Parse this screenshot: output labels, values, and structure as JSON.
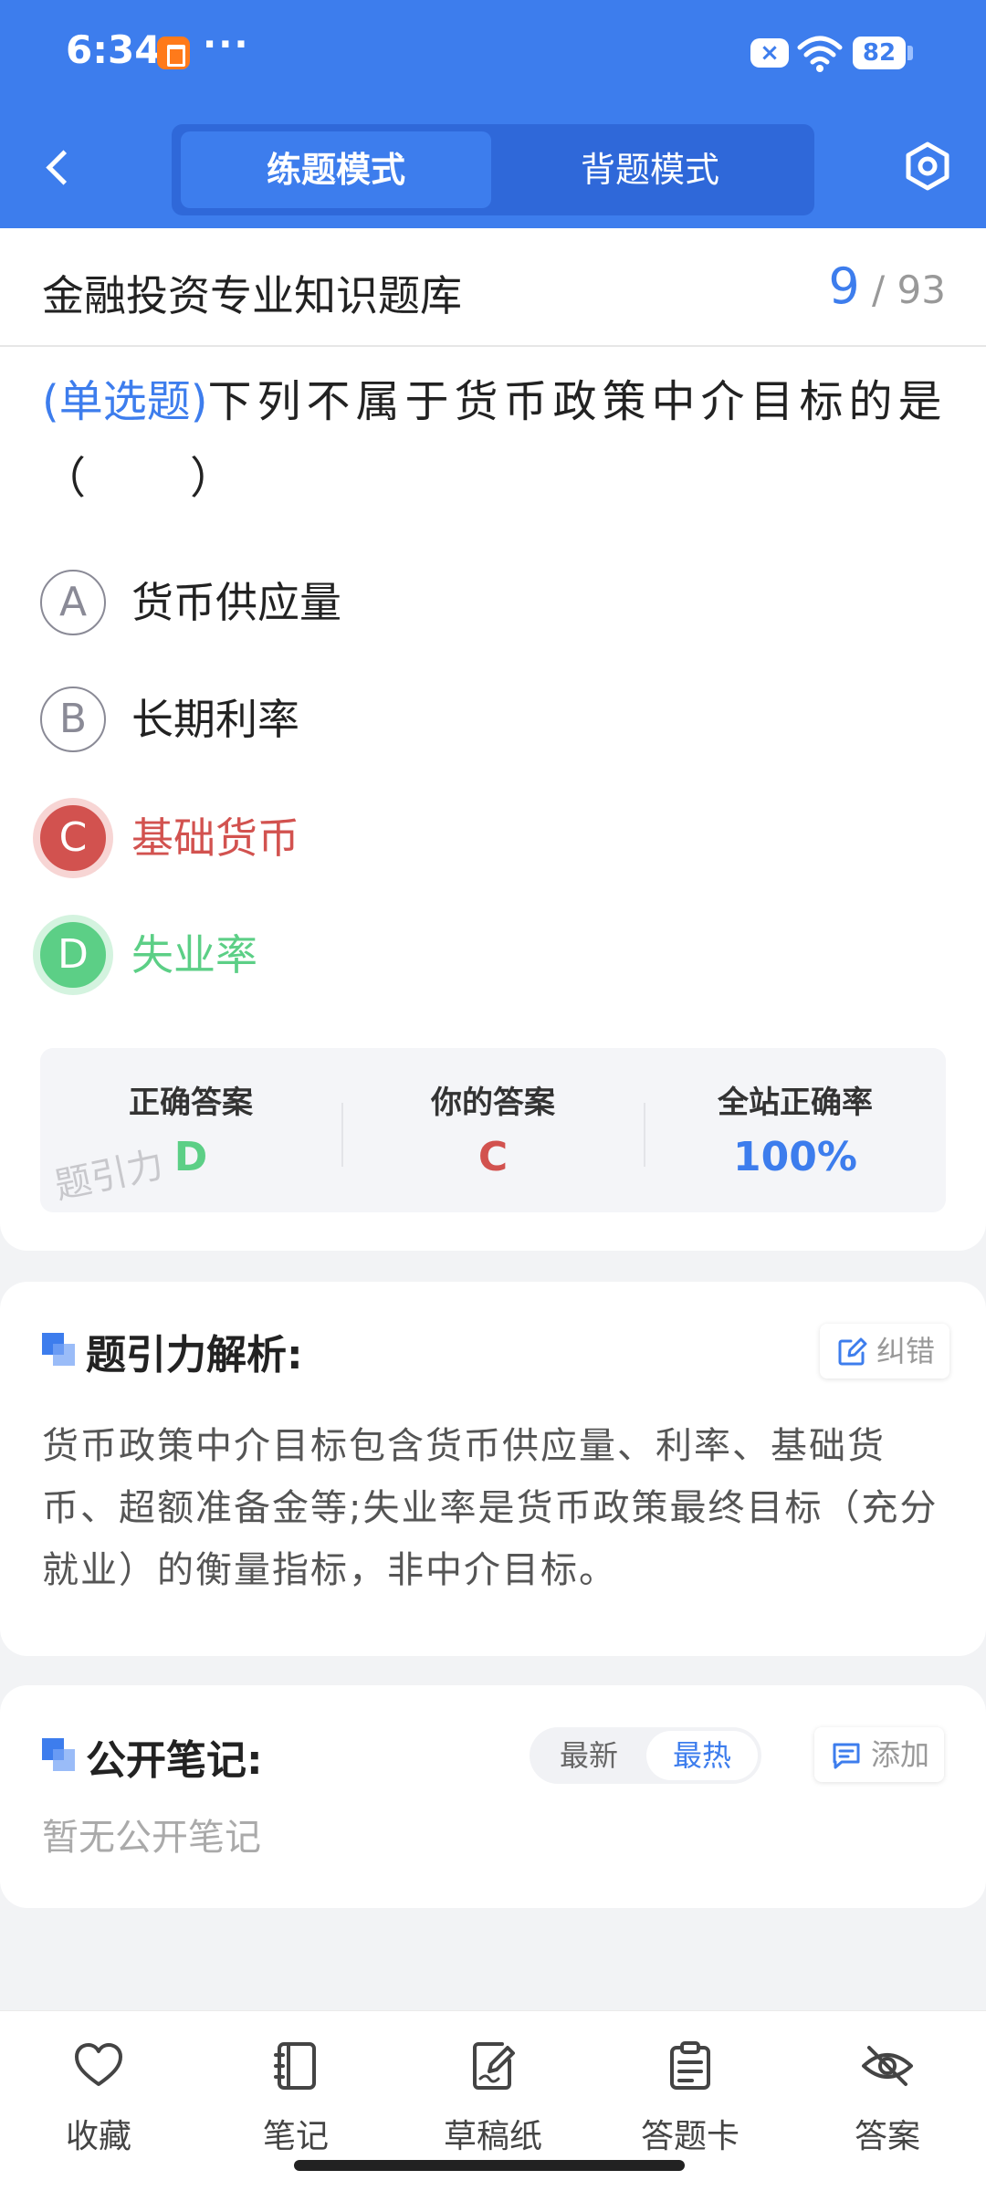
{
  "status_bar": {
    "time": "6:34",
    "more_dots": "···",
    "battery": "82"
  },
  "header": {
    "tabs": [
      {
        "label": "练题模式",
        "active": true
      },
      {
        "label": "背题模式",
        "active": false
      }
    ],
    "accent_color": "#3d7ded"
  },
  "question_bank": {
    "title": "金融投资专业知识题库",
    "current": "9",
    "separator": "/",
    "total": "93"
  },
  "question": {
    "type_label": "(单选题)",
    "text": "下列不属于货币政策中介目标的是（　　）",
    "options": [
      {
        "letter": "A",
        "text": "货币供应量",
        "state": "normal"
      },
      {
        "letter": "B",
        "text": "长期利率",
        "state": "normal"
      },
      {
        "letter": "C",
        "text": "基础货币",
        "state": "wrong"
      },
      {
        "letter": "D",
        "text": "失业率",
        "state": "correct"
      }
    ]
  },
  "answer_summary": {
    "correct_label": "正确答案",
    "correct_value": "D",
    "yours_label": "你的答案",
    "yours_value": "C",
    "rate_label": "全站正确率",
    "rate_value": "100%",
    "watermark": "题引力",
    "colors": {
      "correct": "#5ccf86",
      "wrong": "#d2524f",
      "rate": "#3d7ded"
    }
  },
  "analysis": {
    "title": "题引力解析:",
    "report_label": "纠错",
    "text": "货币政策中介目标包含货币供应量、利率、基础货币、超额准备金等;失业率是货币政策最终目标（充分就业）的衡量指标，非中介目标。"
  },
  "notes": {
    "title": "公开笔记:",
    "sort_latest": "最新",
    "sort_hot": "最热",
    "add_label": "添加",
    "empty_text": "暂无公开笔记"
  },
  "bottom_nav": [
    {
      "label": "收藏",
      "icon": "heart-icon"
    },
    {
      "label": "笔记",
      "icon": "notebook-icon"
    },
    {
      "label": "草稿纸",
      "icon": "draft-paper-icon"
    },
    {
      "label": "答题卡",
      "icon": "answer-card-icon"
    },
    {
      "label": "答案",
      "icon": "eye-off-icon"
    }
  ]
}
